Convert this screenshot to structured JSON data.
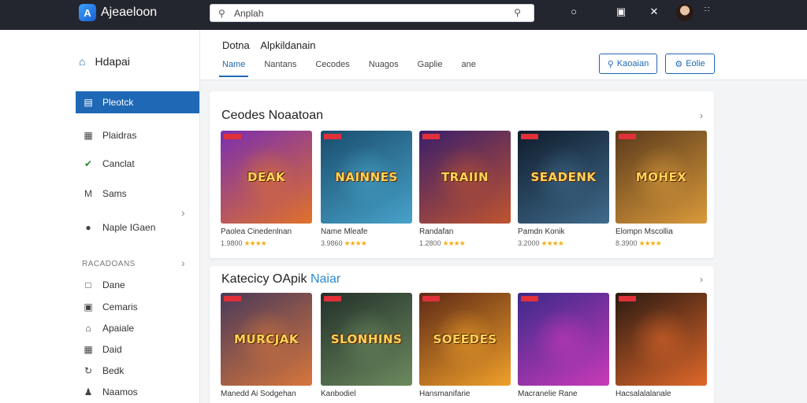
{
  "app": {
    "name": "Ajeaeloon",
    "logo_letter": "A"
  },
  "search": {
    "value": "Anplah",
    "placeholder": "Anplah"
  },
  "topbar_icons": [
    "help-icon",
    "cart-icon",
    "tools-icon",
    "grid-icon"
  ],
  "sidebar": {
    "header": "Hdapai",
    "items": [
      {
        "label": "Pleotck",
        "icon": "chart-icon",
        "active": true
      },
      {
        "label": "Plaidras",
        "icon": "list-icon"
      },
      {
        "label": "Canclat",
        "icon": "check-circle-icon"
      },
      {
        "label": "Sams",
        "icon": "mail-icon"
      },
      {
        "label": "Naple IGaen",
        "icon": "chat-icon"
      }
    ],
    "section_label": "RACADOANS",
    "section_items": [
      {
        "label": "Dane",
        "icon": "doc-icon"
      },
      {
        "label": "Cemaris",
        "icon": "window-icon"
      },
      {
        "label": "Apaiale",
        "icon": "home-icon"
      },
      {
        "label": "Daid",
        "icon": "table-icon"
      },
      {
        "label": "Bedk",
        "icon": "refresh-icon"
      },
      {
        "label": "Naamos",
        "icon": "people-icon"
      }
    ]
  },
  "main": {
    "title_prefix": "Dotna",
    "title_suffix": "Alpkildanain",
    "tabs": [
      {
        "label": "Name",
        "active": true
      },
      {
        "label": "Nantans"
      },
      {
        "label": "Cecodes"
      },
      {
        "label": "Nuagos"
      },
      {
        "label": "Gaplie"
      },
      {
        "label": "ane"
      }
    ],
    "buttons": [
      {
        "label": "Kaoaian",
        "icon": "search-icon"
      },
      {
        "label": "Eolie",
        "icon": "filter-icon"
      }
    ]
  },
  "section1": {
    "title": "Ceodes Noaatoan",
    "games": [
      {
        "title": "Paolea Cinedenlnan",
        "meta": "1.9800",
        "word": "DEAK",
        "colors": [
          "#7a2fb0",
          "#e0722a"
        ]
      },
      {
        "title": "Name Mleafe",
        "meta": "3.9860",
        "word": "NAINNES",
        "colors": [
          "#1a4d6e",
          "#47a2c9"
        ]
      },
      {
        "title": "Randafan",
        "meta": "1.2800",
        "word": "TRAIIN",
        "colors": [
          "#3a1f6b",
          "#c0542f"
        ]
      },
      {
        "title": "Pamdn Konik",
        "meta": "3.2000",
        "word": "SEADENK",
        "colors": [
          "#101c2c",
          "#3f6b8c"
        ]
      },
      {
        "title": "Elompn Mscollia",
        "meta": "8.3900",
        "word": "MOHEX",
        "colors": [
          "#5a3a1c",
          "#d99a3a"
        ]
      }
    ]
  },
  "section2": {
    "title": "Katecicy OApik",
    "title_accent": "Naiar",
    "games": [
      {
        "title": "Manedd Ai Sodgehan",
        "word": "MURCJAK",
        "colors": [
          "#4a3a5a",
          "#d6763c"
        ]
      },
      {
        "title": "Kanbodiel",
        "word": "SLONHINS",
        "colors": [
          "#23302a",
          "#6c8a5e"
        ]
      },
      {
        "title": "Hansmanifarie",
        "word": "SOEEDES",
        "colors": [
          "#5e2a16",
          "#f0a02a"
        ]
      },
      {
        "title": "Macranelie Rane",
        "word": "",
        "colors": [
          "#3b2a8a",
          "#c93ab8"
        ]
      },
      {
        "title": "Hacsalalalanale",
        "word": "",
        "colors": [
          "#2a1a12",
          "#e0682a"
        ]
      }
    ]
  }
}
